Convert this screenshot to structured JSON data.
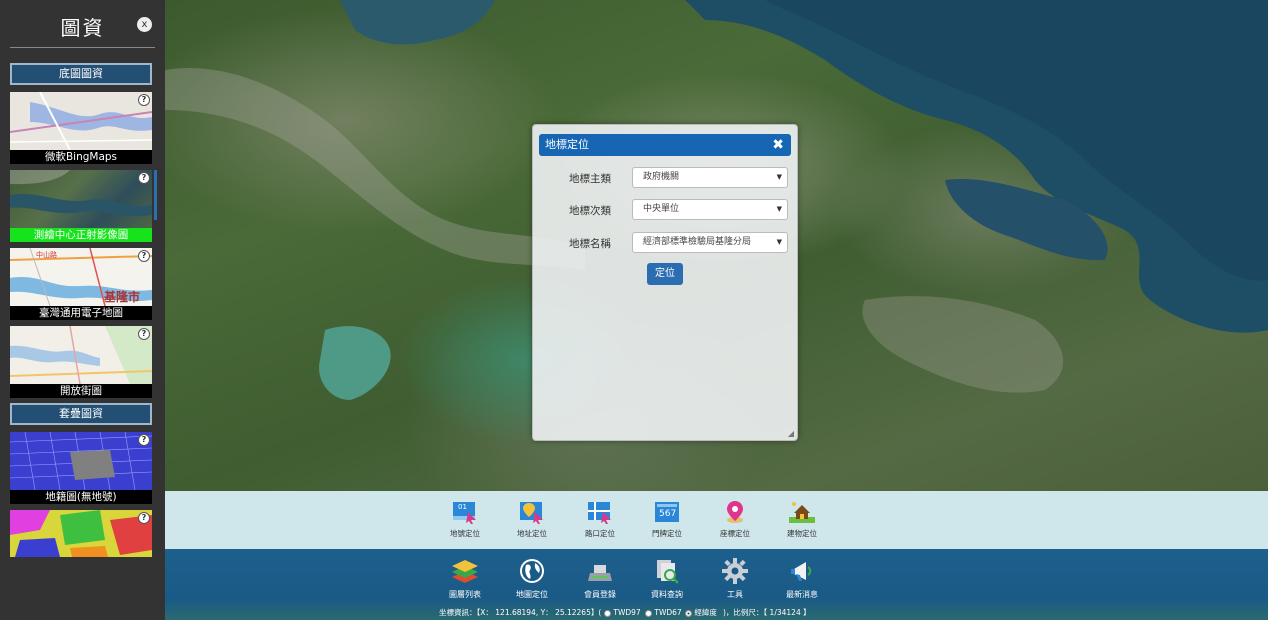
{
  "sidebar": {
    "title": "圖資",
    "close_label": "x",
    "base_header": "底圖圖資",
    "overlay_header": "套疊圖資",
    "base_layers": [
      {
        "label": "微軟BingMaps",
        "active": false
      },
      {
        "label": "測繪中心正射影像圖",
        "active": true
      },
      {
        "label": "臺灣通用電子地圖",
        "active": false
      },
      {
        "label": "開放街圖",
        "active": false
      }
    ],
    "overlay_layers": [
      {
        "label": "地籍圖(無地號)"
      }
    ],
    "help_label": "?",
    "thumb_city_text": "基隆市",
    "thumb_road_text": "中山路"
  },
  "dialog": {
    "title": "地標定位",
    "close_label": "✖",
    "fields": [
      {
        "label": "地標主類",
        "value": "政府機關"
      },
      {
        "label": "地標次類",
        "value": "中央單位"
      },
      {
        "label": "地標名稱",
        "value": "經濟部標準檢驗局基隆分局"
      }
    ],
    "submit_label": "定位",
    "arrow_glyph": "▼"
  },
  "sub_toolbar": [
    {
      "label": "地號定位",
      "icon": "lot-number-icon"
    },
    {
      "label": "地址定位",
      "icon": "address-pin-icon"
    },
    {
      "label": "路口定位",
      "icon": "intersection-icon"
    },
    {
      "label": "門牌定位",
      "icon": "doorplate-icon"
    },
    {
      "label": "座標定位",
      "icon": "coordinate-pin-icon"
    },
    {
      "label": "建物定位",
      "icon": "building-icon"
    }
  ],
  "sub_icon_text": {
    "lot": "01",
    "door": "567"
  },
  "main_toolbar": [
    {
      "label": "圖層列表",
      "icon": "layers-icon"
    },
    {
      "label": "地圖定位",
      "icon": "globe-icon"
    },
    {
      "label": "會員登錄",
      "icon": "member-login-icon"
    },
    {
      "label": "資料查詢",
      "icon": "data-query-icon"
    },
    {
      "label": "工具",
      "icon": "gear-icon"
    },
    {
      "label": "最新消息",
      "icon": "megaphone-icon"
    }
  ],
  "status": {
    "coords_text": "坐標資訊：【X： 121.68194, Y： 25.12265】(",
    "twd97": "TWD97",
    "twd67": "TWD67",
    "wgs": "經緯度",
    "scale_text": ")，比例尺：【  1/34124  】"
  },
  "colors": {
    "sidebar_bg": "#333333",
    "section_header": "#244f74",
    "dialog_header": "#1666b3",
    "active_layer": "#16e31c",
    "sub_toolbar_bg": "#cfe6ea",
    "main_toolbar_bg": "#1a5a86"
  }
}
